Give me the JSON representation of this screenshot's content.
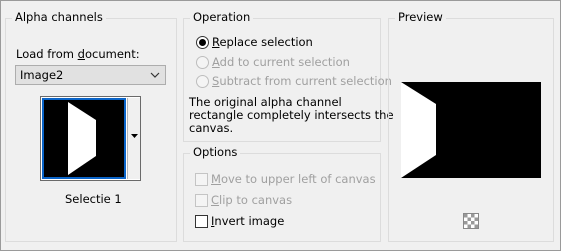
{
  "alpha_channels": {
    "title": "Alpha channels",
    "load_label": "Load from document:",
    "document_value": "Image2",
    "thumbnail_caption": "Selectie 1"
  },
  "operation": {
    "title": "Operation",
    "options": [
      {
        "label": "Replace selection",
        "checked": true,
        "enabled": true
      },
      {
        "label": "Add to current selection",
        "checked": false,
        "enabled": false
      },
      {
        "label": "Subtract from current selection",
        "checked": false,
        "enabled": false
      }
    ],
    "message_line1": "The original alpha channel",
    "message_line2": "rectangle completely intersects the",
    "message_line3": "canvas."
  },
  "options": {
    "title": "Options",
    "items": [
      {
        "label": "Move to upper left of canvas",
        "checked": false,
        "enabled": false
      },
      {
        "label": "Clip to canvas",
        "checked": false,
        "enabled": false
      },
      {
        "label": "Invert image",
        "checked": false,
        "enabled": true
      }
    ]
  },
  "preview": {
    "title": "Preview",
    "checker_icon": "transparency-checker-icon"
  },
  "colors": {
    "selection_border": "#0a64c8",
    "background": "#f0f0f0"
  }
}
